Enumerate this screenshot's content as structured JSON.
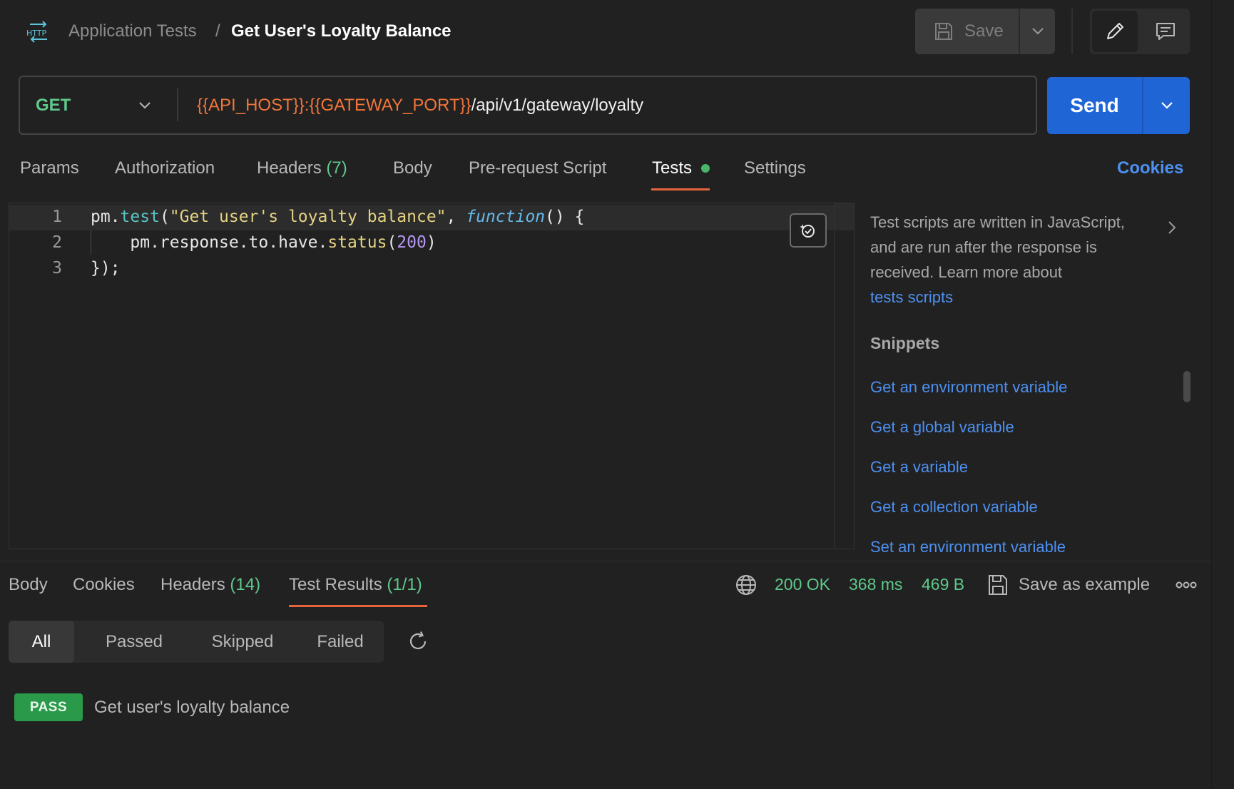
{
  "header": {
    "breadcrumb_parent": "Application Tests",
    "breadcrumb_separator": "/",
    "request_title": "Get User's Loyalty Balance",
    "save_label": "Save"
  },
  "request": {
    "method": "GET",
    "url_var1": "{{API_HOST}}",
    "url_colon": ":",
    "url_var2": "{{GATEWAY_PORT}}",
    "url_path": "/api/v1/gateway/loyalty",
    "send_label": "Send"
  },
  "request_tabs": {
    "params": "Params",
    "authorization": "Authorization",
    "headers": "Headers",
    "headers_count": "(7)",
    "body": "Body",
    "pre_request": "Pre-request Script",
    "tests": "Tests",
    "settings": "Settings",
    "cookies": "Cookies"
  },
  "editor": {
    "line_numbers": [
      "1",
      "2",
      "3"
    ],
    "line1": {
      "obj": "pm.",
      "method": "test",
      "open": "(",
      "str": "\"Get user's loyalty balance\"",
      "sep": ", ",
      "kw": "function",
      "rest": "() {"
    },
    "line2": {
      "prefix": "    pm.response.to.have.",
      "method": "status",
      "open": "(",
      "num": "200",
      "close": ")"
    },
    "line3": "});"
  },
  "side_panel": {
    "description": "Test scripts are written in JavaScript, and are run after the response is received. Learn more about",
    "link": "tests scripts",
    "snippets_heading": "Snippets",
    "snippets": [
      "Get an environment variable",
      "Get a global variable",
      "Get a variable",
      "Get a collection variable",
      "Set an environment variable"
    ]
  },
  "response_tabs": {
    "body": "Body",
    "cookies": "Cookies",
    "headers": "Headers",
    "headers_count": "(14)",
    "test_results": "Test Results",
    "test_results_count": "(1/1)"
  },
  "response_status": {
    "status": "200 OK",
    "time": "368 ms",
    "size": "469 B",
    "save_example": "Save as example"
  },
  "filters": [
    "All",
    "Passed",
    "Skipped",
    "Failed"
  ],
  "results": [
    {
      "badge": "PASS",
      "name": "Get user's loyalty balance"
    }
  ],
  "colors": {
    "accent_orange": "#e8643c",
    "send_blue": "#1f65d6",
    "status_green": "#5fc98b",
    "pass_green": "#2a9a4a",
    "link_blue": "#4d90f0"
  },
  "icons": [
    "http-icon",
    "save-icon",
    "chevron-down-icon",
    "pencil-icon",
    "comment-icon",
    "ai-assist-icon",
    "chevron-right-icon",
    "globe-icon",
    "save-example-icon",
    "more-icon",
    "refresh-icon"
  ]
}
